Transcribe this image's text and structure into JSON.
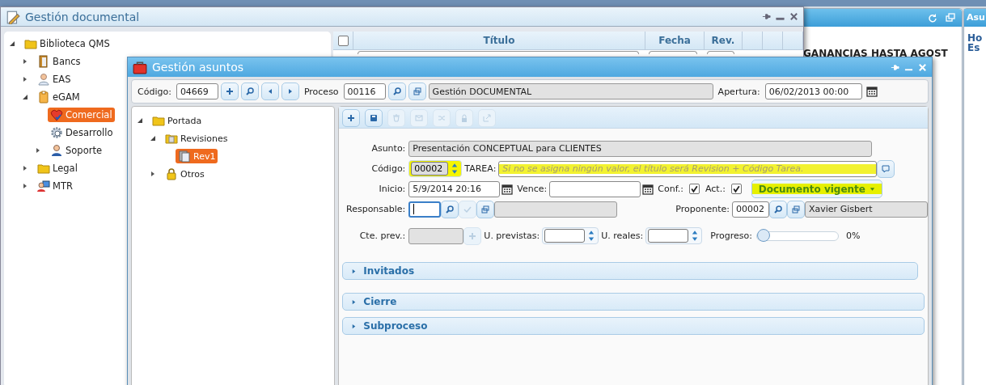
{
  "background_panel": {
    "heading": "GANANCIAS HASTA AGOST"
  },
  "side_panel": {
    "title": "Asu",
    "lines": [
      "Ho",
      "Es"
    ]
  },
  "library_window": {
    "title": "Gestión documental",
    "tree": [
      {
        "label": "Biblioteca QMS",
        "kind": "folder",
        "expanded": true,
        "selected": false,
        "children": [
          {
            "label": "Bancs",
            "kind": "door",
            "expanded": false,
            "selected": false
          },
          {
            "label": "EAS",
            "kind": "person",
            "expanded": false,
            "selected": false
          },
          {
            "label": "eGAM",
            "kind": "clipboard",
            "expanded": true,
            "selected": false,
            "children": [
              {
                "label": "Comercial",
                "kind": "heart",
                "selected": true
              },
              {
                "label": "Desarrollo",
                "kind": "gear",
                "selected": false
              },
              {
                "label": "Soporte",
                "kind": "headset",
                "expanded": false,
                "selected": false
              }
            ]
          },
          {
            "label": "Legal",
            "kind": "folder",
            "expanded": false,
            "selected": false
          },
          {
            "label": "MTR",
            "kind": "network",
            "expanded": false,
            "selected": false
          }
        ]
      }
    ],
    "grid": {
      "columns": [
        "Título",
        "Fecha",
        "Rev."
      ],
      "all_checked": false
    }
  },
  "issue_window": {
    "title": "Gestión asuntos",
    "header": {
      "code_label": "Código:",
      "code": "04669",
      "process_label": "Proceso",
      "process": "00116",
      "process_name": "Gestión DOCUMENTAL",
      "opening_label": "Apertura:",
      "opening": "06/02/2013 00:00"
    },
    "tree": [
      {
        "label": "Portada",
        "kind": "folder",
        "expanded": true,
        "selected": false,
        "children": [
          {
            "label": "Revisiones",
            "kind": "pages",
            "expanded": true,
            "selected": false,
            "children": [
              {
                "label": "Rev1",
                "kind": "document",
                "selected": true
              }
            ]
          },
          {
            "label": "Otros",
            "kind": "lock",
            "expanded": false,
            "selected": false
          }
        ]
      }
    ],
    "toolbar": [
      {
        "kind": "plus",
        "disabled": false
      },
      {
        "kind": "save",
        "disabled": false
      },
      {
        "kind": "trash",
        "disabled": true
      },
      {
        "kind": "mail",
        "disabled": true
      },
      {
        "kind": "shuffle",
        "disabled": true
      },
      {
        "kind": "lock",
        "disabled": true
      },
      {
        "kind": "external",
        "disabled": true
      }
    ],
    "form": {
      "subject_label": "Asunto:",
      "subject": "Presentación CONCEPTUAL para CLIENTES",
      "code_label": "Código:",
      "code": "00002",
      "code_highlighted": true,
      "task_label": "TAREA:",
      "task_placeholder": "Si no se asigna ningún valor, el título será Revision + Código Tarea.",
      "task_highlighted": true,
      "start_label": "Inicio:",
      "start": "5/9/2014 20:16",
      "due_label": "Vence:",
      "conf_label": "Conf.:",
      "conf_checked": true,
      "act_label": "Act.:",
      "act_checked": true,
      "status": "Documento vigente",
      "status_highlighted": true,
      "responsible_label": "Responsable:",
      "proposer_label": "Proponente:",
      "proposer": "00002",
      "proposer_name": "Xavier Gisbert",
      "cost_label": "Cte. prev.:",
      "planned_label": "U. previstas:",
      "actual_label": "U. reales:",
      "progress_label": "Progreso:",
      "progress": {
        "level": 0
      },
      "progress_reading": "0%"
    },
    "sections": [
      {
        "title": "Invitados",
        "expanded": false
      },
      {
        "title": "Cierre",
        "expanded": false
      },
      {
        "title": "Subproceso",
        "expanded": false
      }
    ]
  }
}
